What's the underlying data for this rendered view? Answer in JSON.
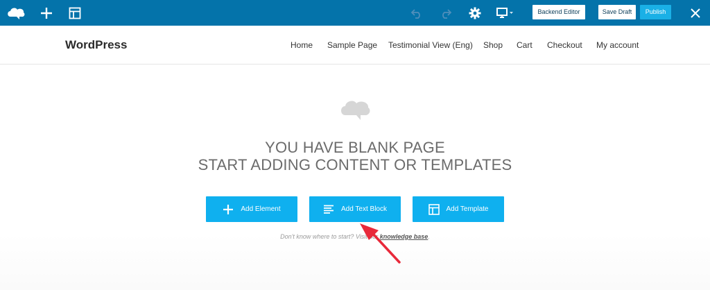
{
  "toolbar": {
    "background": "#0473aa",
    "logo_icon": "cloud-logo-icon",
    "add_icon": "plus-icon",
    "layout_icon": "layout-icon",
    "undo_icon": "undo-icon",
    "redo_icon": "redo-icon",
    "settings_icon": "gear-icon",
    "responsive_icon": "monitor-icon",
    "backend_editor_label": "Backend Editor",
    "save_draft_label": "Save Draft",
    "publish_label": "Publish",
    "close_icon": "close-icon",
    "publish_color": "#1ab0e6"
  },
  "site": {
    "title": "WordPress",
    "nav": [
      "Home",
      "Sample Page",
      "Testimonial View (Eng)",
      "Shop",
      "Cart",
      "Checkout",
      "My account"
    ]
  },
  "main": {
    "logo_icon": "cloud-logo-icon",
    "headline_line1": "YOU HAVE BLANK PAGE",
    "headline_line2": "START ADDING CONTENT OR TEMPLATES",
    "buttons": [
      {
        "label": "Add Element",
        "icon": "plus-icon"
      },
      {
        "label": "Add Text Block",
        "icon": "text-block-icon"
      },
      {
        "label": "Add Template",
        "icon": "template-icon"
      }
    ],
    "button_color": "#0fb0ef",
    "help_prefix": "Don't know where to start? Visit our ",
    "help_link": "knowledge base",
    "help_suffix": "."
  },
  "annotation": {
    "arrow_color": "#e8293a"
  }
}
